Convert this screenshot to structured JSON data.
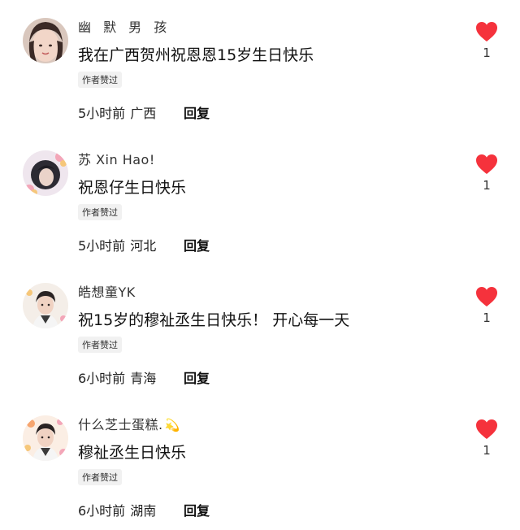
{
  "colors": {
    "heart": "#f5323c",
    "badge_bg": "#f1f1f1"
  },
  "comments": [
    {
      "username": "幽 默 男 孩",
      "text": "我在广西贺州祝恩恩15岁生日快乐",
      "badge": "作者赞过",
      "time": "5小时前",
      "location": "广西",
      "reply_label": "回复",
      "likes": "1",
      "like_icon": "heart-filled-icon"
    },
    {
      "username": "苏 Xin Hao!",
      "text": "祝恩仔生日快乐",
      "badge": "作者赞过",
      "time": "5小时前",
      "location": "河北",
      "reply_label": "回复",
      "likes": "1",
      "like_icon": "heart-filled-icon"
    },
    {
      "username": "皓想童YK",
      "text": "祝15岁的穆祉丞生日快乐！ 开心每一天",
      "badge": "作者赞过",
      "time": "6小时前",
      "location": "青海",
      "reply_label": "回复",
      "likes": "1",
      "like_icon": "heart-filled-icon"
    },
    {
      "username": "什么芝士蛋糕.",
      "username_emoji": "💫",
      "text": "穆祉丞生日快乐",
      "badge": "作者赞过",
      "time": "6小时前",
      "location": "湖南",
      "reply_label": "回复",
      "likes": "1",
      "like_icon": "heart-filled-icon"
    }
  ]
}
